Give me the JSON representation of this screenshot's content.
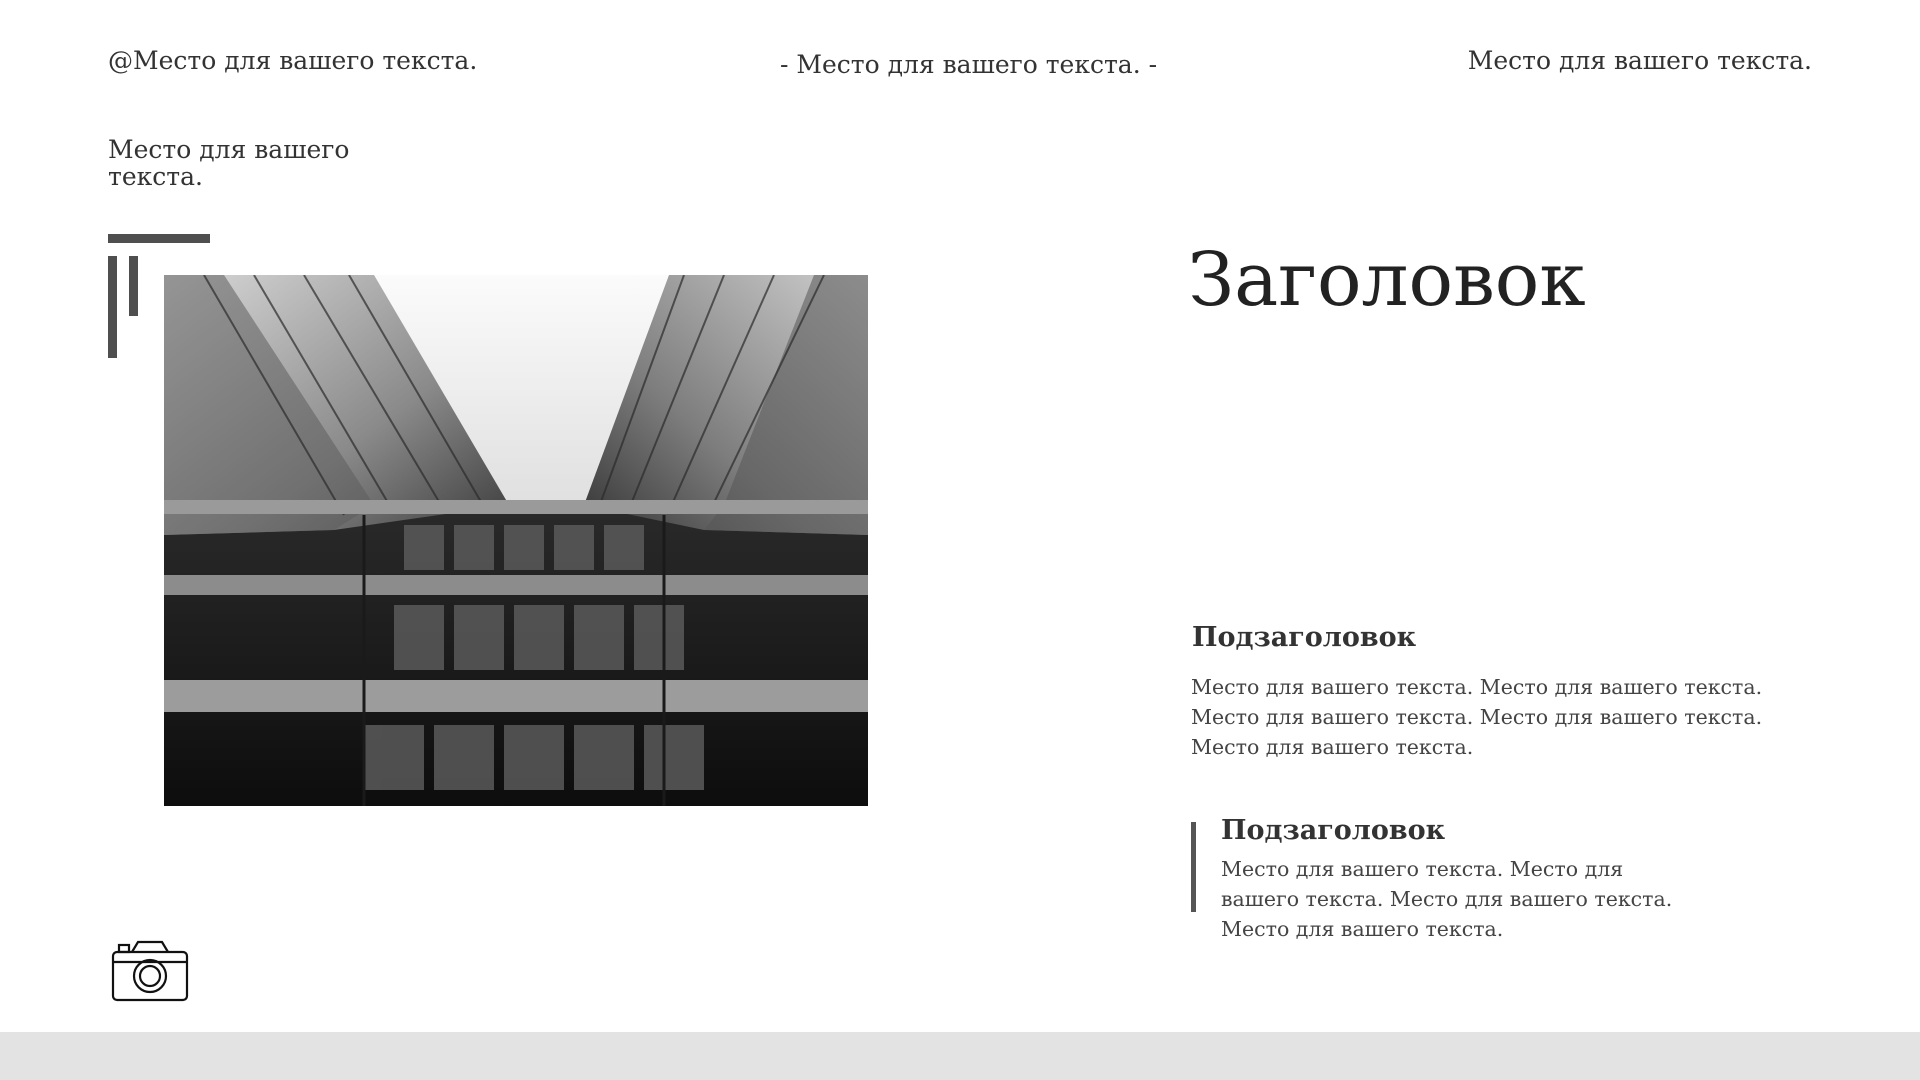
{
  "header": {
    "left": "@Место для вашего текста.",
    "center": "- Место для вашего текста. -",
    "right": "Место для вашего текста."
  },
  "side_note": "Место для вашего текста.",
  "photo": {
    "subject": "architecture-photo",
    "tone": "black-and-white"
  },
  "icons": {
    "camera": "camera-icon"
  },
  "main": {
    "title": "Заголовок",
    "section1": {
      "title": "Подзаголовок",
      "body": "Место для вашего текста. Место для вашего текста. Место для вашего текста. Место для вашего текста. Место для вашего текста."
    },
    "section2": {
      "title": "Подзаголовок",
      "body": "Место для вашего текста. Место для вашего текста. Место для вашего текста. Место для вашего текста."
    }
  },
  "colors": {
    "accent": "#4f4f4f",
    "text": "#333333",
    "footer": "#e3e3e3",
    "background": "#ffffff"
  }
}
